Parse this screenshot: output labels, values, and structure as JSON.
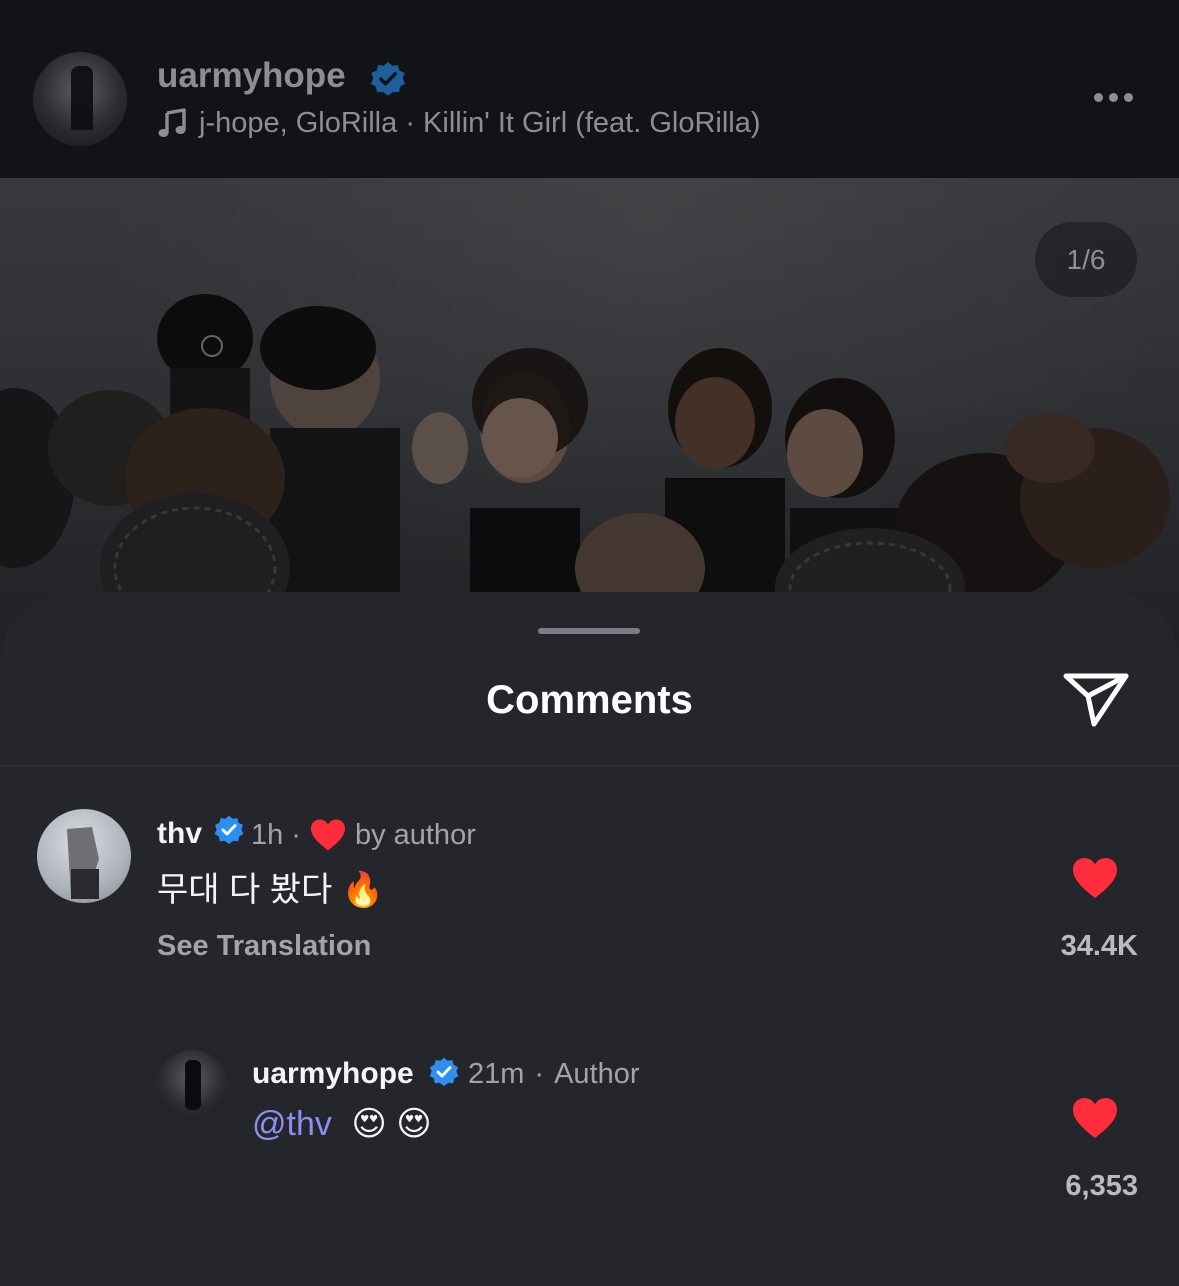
{
  "post": {
    "username": "uarmyhope",
    "music": "j-hope, GloRilla · Killin' It Girl (feat. GloRilla)",
    "icons": {
      "avatar": "avatar",
      "verified": "verified-badge-icon",
      "music": "music-note-icon",
      "more": "more-options-icon"
    },
    "image_counter": "1/6"
  },
  "sheet": {
    "title": "Comments",
    "share_icon": "paper-plane-icon"
  },
  "comments": [
    {
      "username": "thv",
      "time": "1h",
      "separator": "·",
      "liked_by_author_label": "by author",
      "text": "무대 다 봤다",
      "emoji": "🔥",
      "see_translation": "See Translation",
      "like_count": "34.4K",
      "liked": true
    },
    {
      "username": "uarmyhope",
      "time": "21m",
      "separator": "·",
      "author_label": "Author",
      "mention": "@thv",
      "emojis": "😍 😍",
      "like_count": "6,353",
      "liked": true
    }
  ],
  "colors": {
    "like_red": "#ff2d3b",
    "verified_blue": "#2f8ff0",
    "mention": "#8d8ef0"
  }
}
